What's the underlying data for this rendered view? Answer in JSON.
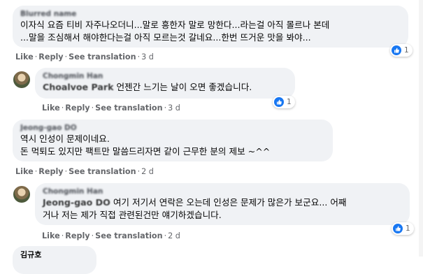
{
  "comments": [
    {
      "author": "Blurred name",
      "lines": [
        "이자식 요즘 티비 자주나오더니...말로 흥한자 말로 망한다...라는걸 아직 몰르나 본데",
        "...말을 조심해서 해야한다는걸 아직 모르는것 갈네요...한번 뜨거운 맛을 봐야..."
      ],
      "actions": {
        "like": "Like",
        "reply": "Reply",
        "translate": "See translation",
        "age": "3 d"
      },
      "reactions": "1"
    },
    {
      "author": "Chongmin Han",
      "tag": "Choalvoe Park",
      "text": "언젠간 느기는 날이 오면 좋겠습니다.",
      "actions": {
        "like": "Like",
        "reply": "Reply",
        "translate": "See translation",
        "age": "3 d"
      },
      "reactions": "1"
    },
    {
      "author": "Jeong-gao DO",
      "lines": [
        "역시 인성이 문제이네요.",
        "돈 먹퇴도 있지만 팩트만 말씀드리자면 같이 근무한 분의 제보 ~^^"
      ],
      "actions": {
        "like": "Like",
        "reply": "Reply",
        "translate": "See translation",
        "age": "2 d"
      }
    },
    {
      "author": "Chongmin Han",
      "tag": "Jeong-gao DO",
      "line1_rest": "여기 저기서 연락은 오는데 인성은 문제가 많은가 보군요... 어째",
      "line2": "거나 저는 제가 직접 관련된건만 얘기하겠습니다.",
      "actions": {
        "like": "Like",
        "reply": "Reply",
        "translate": "See translation",
        "age": "2 d"
      },
      "reactions": "1"
    },
    {
      "author": "김규호"
    }
  ],
  "icons": {
    "like": "like-thumb-icon",
    "avatar": "profile-avatar"
  },
  "colors": {
    "bubble": "#f0f2f5",
    "accent": "#1877f2",
    "meta": "#65676b"
  }
}
